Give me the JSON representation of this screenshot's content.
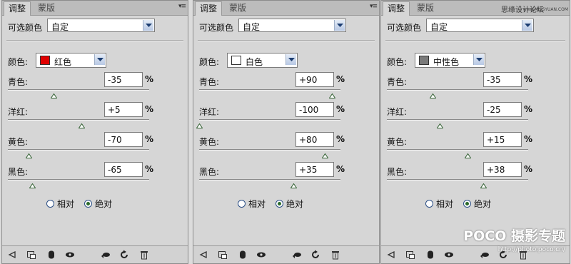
{
  "tabs": [
    "调整",
    "蒙版"
  ],
  "tab_menu_glyph": "▾≡",
  "preset_label": "可选颜色",
  "preset_value": "自定",
  "color_label": "颜色:",
  "pct_symbol": "%",
  "radio_relative": "相对",
  "radio_absolute": "绝对",
  "watermark": "思缘设计论坛",
  "watermark_url": "www.MISSYUAN.COM",
  "logo": "POCO 摄影专题",
  "logo_url": "http://photo.poco.cn/",
  "bottom_icons": [
    "back-arrow-icon",
    "clip-icon",
    "layer-mask-icon",
    "visibility-eye-icon",
    "view-previous-icon",
    "reset-icon",
    "trash-icon"
  ],
  "panels": [
    {
      "color_name": "红色",
      "swatch": "#e00000",
      "sliders": [
        {
          "label": "青色:",
          "value": "-35",
          "level": -35
        },
        {
          "label": "洋红:",
          "value": "+5",
          "level": 5
        },
        {
          "label": "黄色:",
          "value": "-70",
          "level": -70
        },
        {
          "label": "黑色:",
          "value": "-65",
          "level": -65
        }
      ],
      "absolute_selected": true
    },
    {
      "color_name": "白色",
      "swatch": "#ffffff",
      "sliders": [
        {
          "label": "青色:",
          "value": "+90",
          "level": 90
        },
        {
          "label": "洋红:",
          "value": "-100",
          "level": -100
        },
        {
          "label": "黄色:",
          "value": "+80",
          "level": 80
        },
        {
          "label": "黑色:",
          "value": "+35",
          "level": 35
        }
      ],
      "absolute_selected": true
    },
    {
      "color_name": "中性色",
      "swatch": "#7a7a7a",
      "sliders": [
        {
          "label": "青色:",
          "value": "-35",
          "level": -35
        },
        {
          "label": "洋红:",
          "value": "-25",
          "level": -25
        },
        {
          "label": "黄色:",
          "value": "+15",
          "level": 15
        },
        {
          "label": "黑色:",
          "value": "+38",
          "level": 38
        }
      ],
      "absolute_selected": true
    }
  ]
}
